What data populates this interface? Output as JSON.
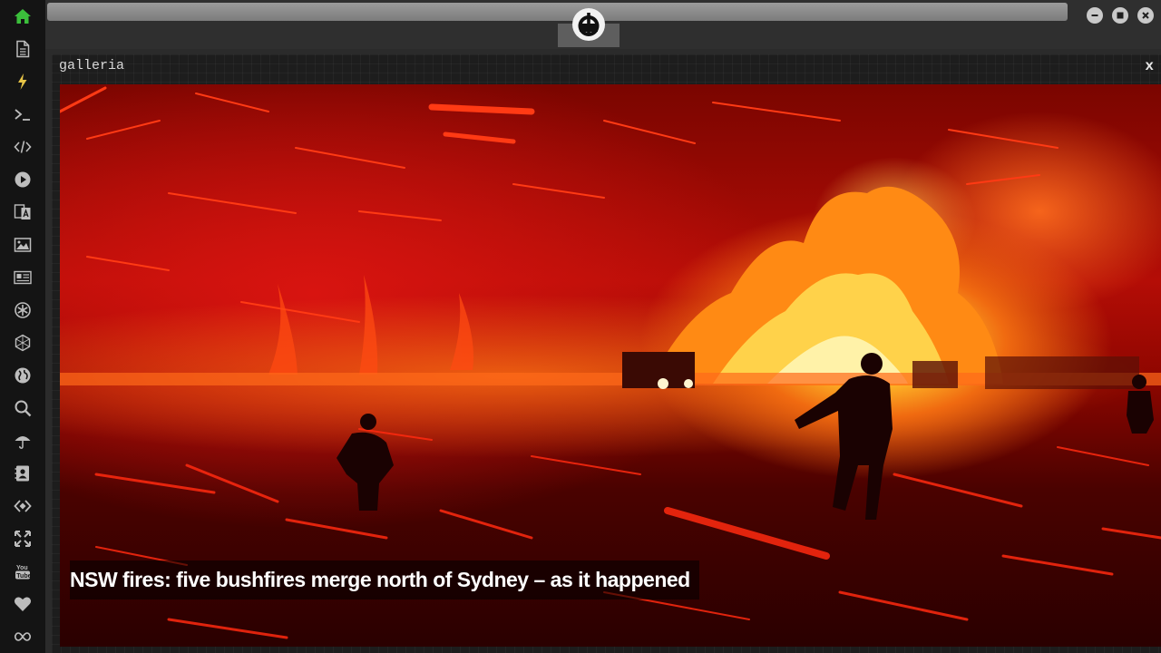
{
  "window": {
    "title": "galleria",
    "close_label": "x"
  },
  "sidebar": {
    "items": [
      {
        "icon": "home-icon",
        "color": "#3bbf3b"
      },
      {
        "icon": "document-icon",
        "color": "#bdbdbd"
      },
      {
        "icon": "lightning-icon",
        "color": "#e8c547"
      },
      {
        "icon": "terminal-icon",
        "color": "#bdbdbd"
      },
      {
        "icon": "code-icon",
        "color": "#bdbdbd"
      },
      {
        "icon": "play-icon",
        "color": "#bdbdbd"
      },
      {
        "icon": "translate-icon",
        "color": "#bdbdbd"
      },
      {
        "icon": "image-icon",
        "color": "#bdbdbd"
      },
      {
        "icon": "newspaper-icon",
        "color": "#bdbdbd"
      },
      {
        "icon": "settings-wheel-icon",
        "color": "#bdbdbd"
      },
      {
        "icon": "hexagon-icon",
        "color": "#bdbdbd"
      },
      {
        "icon": "globe-icon",
        "color": "#bdbdbd"
      },
      {
        "icon": "search-icon",
        "color": "#bdbdbd"
      },
      {
        "icon": "umbrella-icon",
        "color": "#bdbdbd"
      },
      {
        "icon": "contact-card-icon",
        "color": "#bdbdbd"
      },
      {
        "icon": "diamond-code-icon",
        "color": "#bdbdbd"
      },
      {
        "icon": "expand-icon",
        "color": "#bdbdbd"
      },
      {
        "icon": "youtube-icon",
        "color": "#bdbdbd"
      },
      {
        "icon": "heart-icon",
        "color": "#bdbdbd"
      },
      {
        "icon": "infinity-icon",
        "color": "#bdbdbd"
      }
    ]
  },
  "topbar": {
    "logo_icon": "rebel-alliance-icon",
    "buttons": [
      "minimize-icon",
      "maximize-icon",
      "close-icon"
    ]
  },
  "gallery": {
    "caption": "NSW fires: five bushfires merge north of Sydney – as it happened",
    "image_description_icon": "bushfire-photo"
  },
  "colors": {
    "sidebar_bg": "#141414",
    "panel_bg": "#1d1d1d",
    "accent_green": "#3bbf3b",
    "accent_yellow": "#e8c547"
  }
}
